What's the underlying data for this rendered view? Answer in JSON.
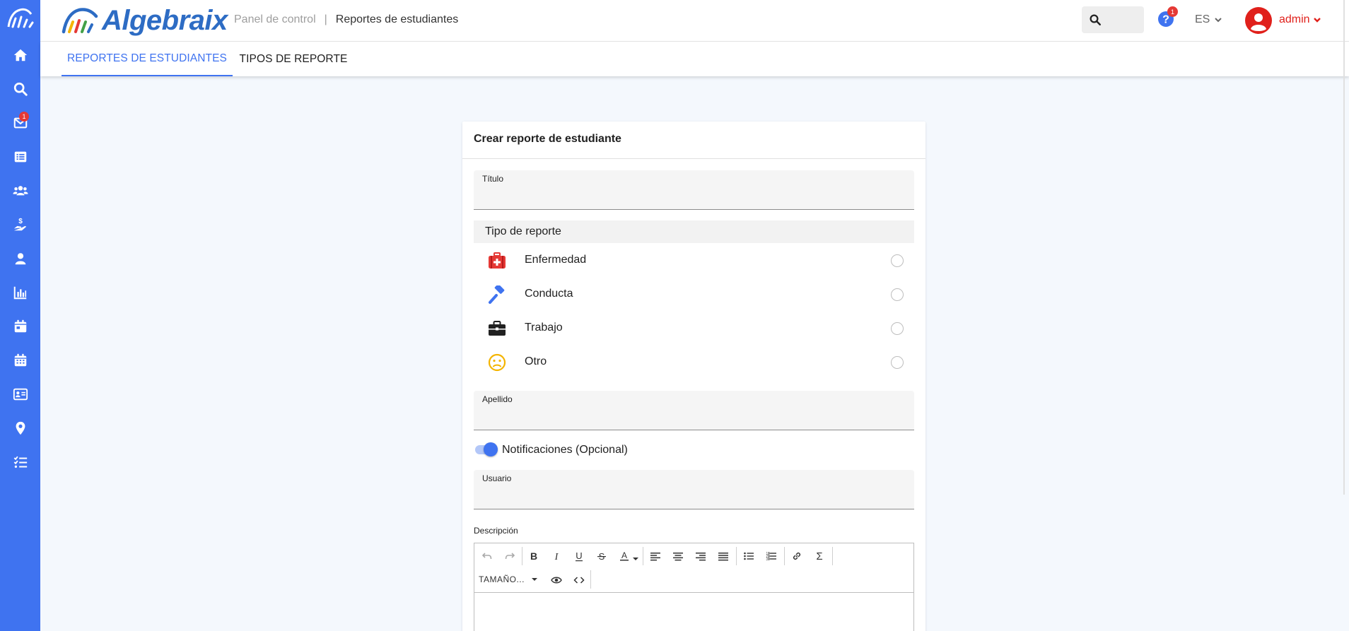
{
  "app": {
    "brand_name": "Algebraix",
    "accent_color": "#3f73f0",
    "sidebar_color": "#3f73f0"
  },
  "header": {
    "breadcrumb": [
      "Panel de control",
      "Reportes de estudiantes"
    ],
    "breadcrumb_separator": "|",
    "help_badge": "1",
    "language": "ES",
    "username": "admin"
  },
  "sidebar": {
    "items": [
      {
        "icon": "home-icon"
      },
      {
        "icon": "search-icon"
      },
      {
        "icon": "mail-icon",
        "badge": "1"
      },
      {
        "icon": "list-icon"
      },
      {
        "icon": "users-icon"
      },
      {
        "icon": "payment-hand-icon"
      },
      {
        "icon": "user-icon"
      },
      {
        "icon": "chart-icon"
      },
      {
        "icon": "calendar-day-icon"
      },
      {
        "icon": "calendar-icon"
      },
      {
        "icon": "id-card-icon"
      },
      {
        "icon": "location-icon"
      },
      {
        "icon": "tasks-icon"
      }
    ]
  },
  "tabs": [
    {
      "label": "REPORTES DE ESTUDIANTES",
      "active": true
    },
    {
      "label": "TIPOS DE REPORTE",
      "active": false
    }
  ],
  "form": {
    "title": "Crear reporte de estudiante",
    "titulo_label": "Título",
    "titulo_value": "",
    "report_type_header": "Tipo de reporte",
    "report_types": [
      {
        "label": "Enfermedad",
        "icon": "first-aid-kit-icon",
        "color": "#e53935",
        "selected": false
      },
      {
        "label": "Conducta",
        "icon": "gavel-icon",
        "color": "#3f73f0",
        "selected": false
      },
      {
        "label": "Trabajo",
        "icon": "briefcase-icon",
        "color": "#212121",
        "selected": false
      },
      {
        "label": "Otro",
        "icon": "sad-face-icon",
        "color": "#f4b400",
        "selected": false
      }
    ],
    "apellido_label": "Apellido",
    "apellido_value": "",
    "notifications_label": "Notificaciones (Opcional)",
    "notifications_on": true,
    "usuario_label": "Usuario",
    "usuario_value": "",
    "descripcion_label": "Descripción",
    "editor": {
      "font_size_label": "TAMAÑO...",
      "sigma": "Σ"
    }
  }
}
